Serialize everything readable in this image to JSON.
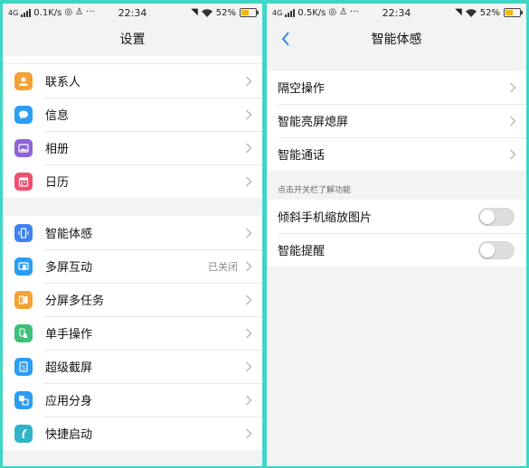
{
  "left": {
    "status_bar": {
      "network": "4G",
      "speed": "0.1K/s",
      "time": "22:34",
      "battery": "52%",
      "battery_level": 0.52
    },
    "title": "设置",
    "group1": [
      {
        "label": "联系人",
        "icon": "contacts-icon",
        "color": "#f4a233"
      },
      {
        "label": "信息",
        "icon": "message-icon",
        "color": "#2a9df4"
      },
      {
        "label": "相册",
        "icon": "gallery-icon",
        "color": "#8e63d8"
      },
      {
        "label": "日历",
        "icon": "calendar-icon",
        "color": "#f0506e"
      }
    ],
    "group2": [
      {
        "label": "智能体感",
        "icon": "smart-motion-icon",
        "color": "#3f82ee",
        "status": ""
      },
      {
        "label": "多屏互动",
        "icon": "multi-screen-icon",
        "color": "#2a9df4",
        "status": "已关闭"
      },
      {
        "label": "分屏多任务",
        "icon": "split-screen-icon",
        "color": "#f4a233",
        "status": ""
      },
      {
        "label": "单手操作",
        "icon": "one-hand-icon",
        "color": "#3cc07a",
        "status": ""
      },
      {
        "label": "超级截屏",
        "icon": "screenshot-icon",
        "color": "#2a9df4",
        "status": ""
      },
      {
        "label": "应用分身",
        "icon": "app-clone-icon",
        "color": "#2a9df4",
        "status": ""
      },
      {
        "label": "快捷启动",
        "icon": "quick-launch-icon",
        "color": "#2fb4c9",
        "status": ""
      }
    ]
  },
  "right": {
    "status_bar": {
      "network": "4G",
      "speed": "0.5K/s",
      "time": "22:34",
      "battery": "52%",
      "battery_level": 0.52
    },
    "title": "智能体感",
    "group1": [
      {
        "label": "隔空操作"
      },
      {
        "label": "智能亮屏熄屏"
      },
      {
        "label": "智能通话"
      }
    ],
    "section_label": "点击开关栏了解功能",
    "toggles": [
      {
        "label": "倾斜手机缩放图片",
        "on": false
      },
      {
        "label": "智能提醒",
        "on": false
      }
    ]
  }
}
